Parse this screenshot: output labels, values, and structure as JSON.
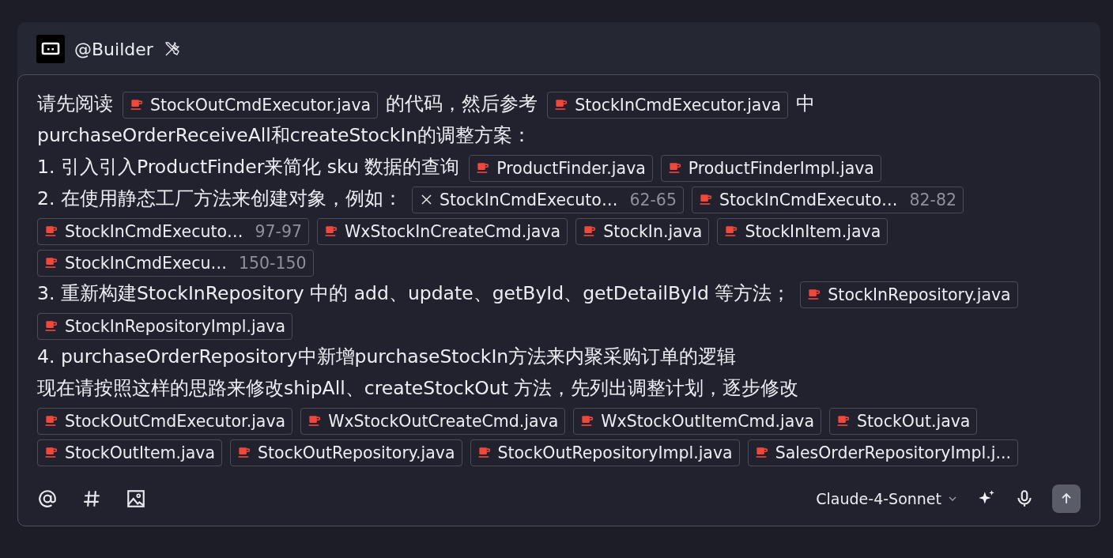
{
  "header": {
    "agent": "@Builder"
  },
  "prompt": {
    "paragraphs": [
      {
        "segments": [
          {
            "kind": "text",
            "text": "请先阅读"
          },
          {
            "kind": "file",
            "name": "StockOutCmdExecutor.java"
          },
          {
            "kind": "text",
            "text": "的代码，然后参考"
          },
          {
            "kind": "file",
            "name": "StockInCmdExecutor.java"
          },
          {
            "kind": "text",
            "text": "中"
          },
          {
            "kind": "break"
          },
          {
            "kind": "text",
            "text": "purchaseOrderReceiveAll和createStockIn的调整方案："
          }
        ]
      },
      {
        "segments": [
          {
            "kind": "text",
            "text": "1. 引入引入ProductFinder来简化 sku 数据的查询"
          },
          {
            "kind": "file",
            "name": "ProductFinder.java"
          },
          {
            "kind": "file",
            "name": "ProductFinderImpl.java"
          }
        ]
      },
      {
        "segments": [
          {
            "kind": "text",
            "text": "2. 在使用静态工厂方法来创建对象，例如："
          },
          {
            "kind": "file_hover",
            "name": "StockInCmdExecuto…",
            "range": "62-65"
          },
          {
            "kind": "file",
            "name": "StockInCmdExecuto…",
            "range": "82-82"
          },
          {
            "kind": "file",
            "name": "StockInCmdExecuto…",
            "range": "97-97"
          },
          {
            "kind": "file",
            "name": "WxStockInCreateCmd.java"
          },
          {
            "kind": "file",
            "name": "StockIn.java"
          },
          {
            "kind": "file",
            "name": "StockInItem.java"
          },
          {
            "kind": "file",
            "name": "StockInCmdExecu…",
            "range": "150-150"
          }
        ]
      },
      {
        "segments": [
          {
            "kind": "text",
            "text": "3. 重新构建StockInRepository 中的 add、update、getById、getDetailById 等方法；"
          },
          {
            "kind": "file",
            "name": "StockInRepository.java"
          },
          {
            "kind": "file",
            "name": "StockInRepositoryImpl.java"
          }
        ]
      },
      {
        "segments": [
          {
            "kind": "text",
            "text": "4. purchaseOrderRepository中新增purchaseStockIn方法来内聚采购订单的逻辑"
          }
        ]
      },
      {
        "segments": [
          {
            "kind": "text",
            "text": "现在请按照这样的思路来修改shipAll、createStockOut 方法，先列出调整计划，逐步修改"
          },
          {
            "kind": "break"
          },
          {
            "kind": "file",
            "name": "StockOutCmdExecutor.java"
          },
          {
            "kind": "file",
            "name": "WxStockOutCreateCmd.java"
          },
          {
            "kind": "file",
            "name": "WxStockOutItemCmd.java"
          },
          {
            "kind": "file",
            "name": "StockOut.java"
          },
          {
            "kind": "file",
            "name": "StockOutItem.java"
          },
          {
            "kind": "file",
            "name": "StockOutRepository.java"
          },
          {
            "kind": "file",
            "name": "StockOutRepositoryImpl.java"
          },
          {
            "kind": "file",
            "name": "SalesOrderRepositoryImpl.j..."
          }
        ]
      }
    ]
  },
  "toolbar": {
    "model": "Claude-4-Sonnet"
  }
}
